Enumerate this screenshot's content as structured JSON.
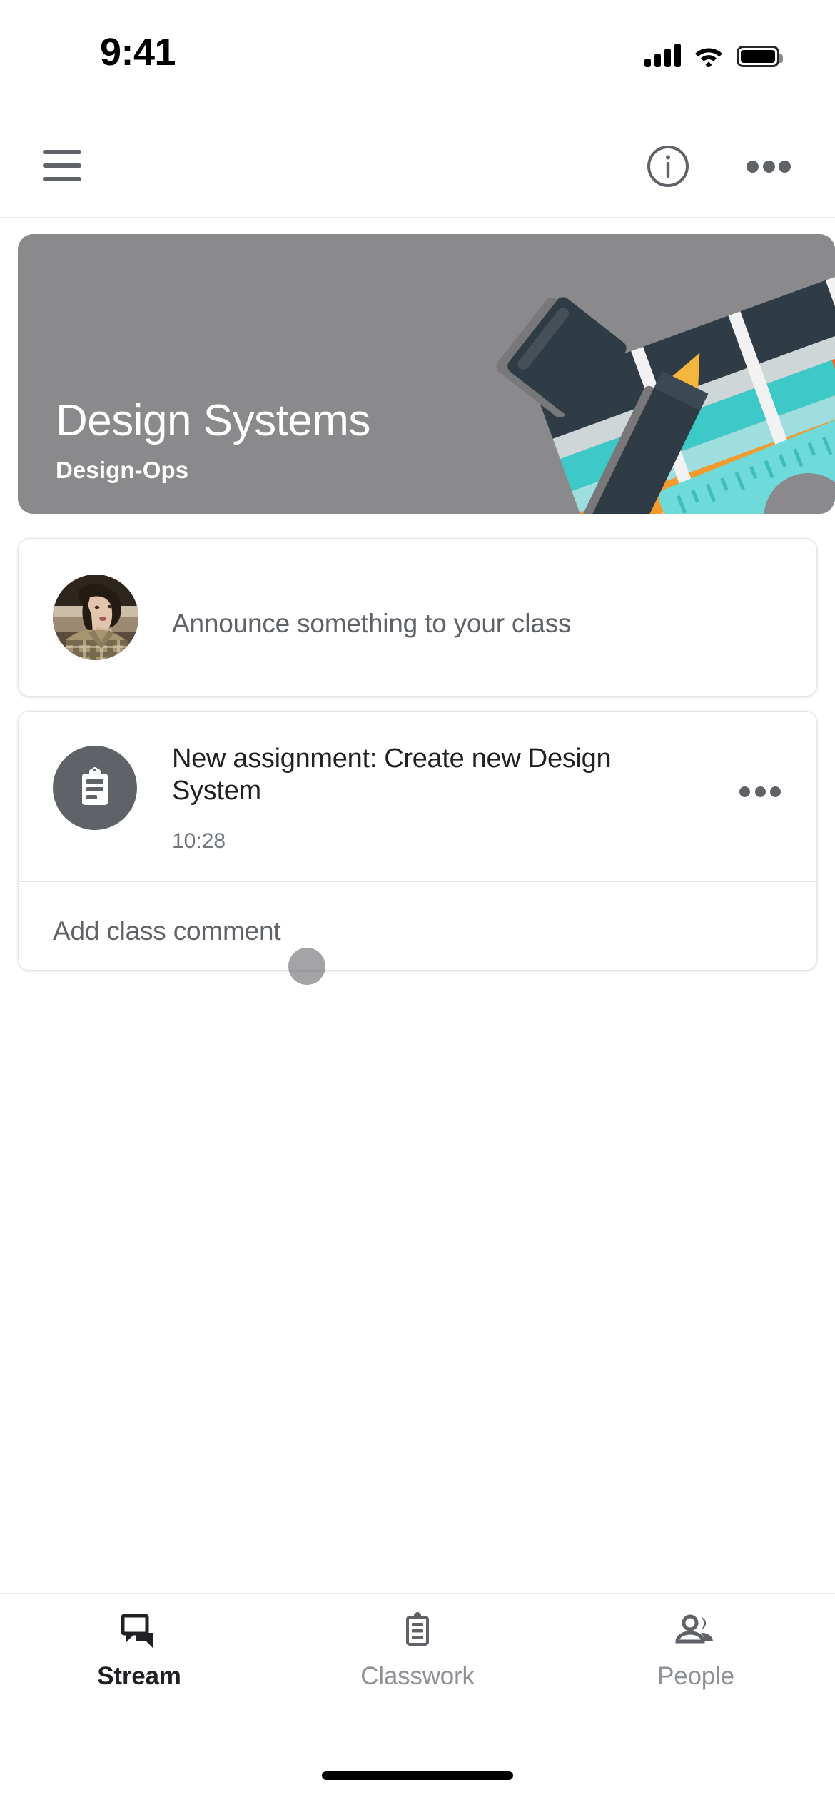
{
  "status_bar": {
    "time": "9:41",
    "signal_icon": "cellular-signal-icon",
    "wifi_icon": "wifi-icon",
    "battery_icon": "battery-full-icon"
  },
  "app_bar": {
    "menu_icon": "hamburger-menu-icon",
    "info_icon": "info-circle-icon",
    "overflow_icon": "more-options-icon"
  },
  "class_banner": {
    "title": "Design Systems",
    "subtitle": "Design-Ops",
    "background_color": "#8a8a8d",
    "illustration": "design-tools-illustration"
  },
  "announce_card": {
    "avatar_name": "user-avatar",
    "placeholder": "Announce something to your class"
  },
  "assignment_card": {
    "icon": "assignment-clipboard-icon",
    "title": "New assignment: Create new Design System",
    "time": "10:28",
    "overflow_icon": "more-options-icon",
    "comment_placeholder": "Add class comment"
  },
  "touch_indicator": {
    "name": "touch-point",
    "color": "#5a5a5f"
  },
  "bottom_nav": {
    "items": [
      {
        "label": "Stream",
        "icon": "stream-chat-icon",
        "active": true
      },
      {
        "label": "Classwork",
        "icon": "classwork-clipboard-icon",
        "active": false
      },
      {
        "label": "People",
        "icon": "people-group-icon",
        "active": false
      }
    ]
  },
  "colors": {
    "text_primary": "#202124",
    "text_secondary": "#5f6368",
    "text_muted": "#8e9296",
    "card_border": "#e4e4e4",
    "banner": "#8a8a8d"
  }
}
